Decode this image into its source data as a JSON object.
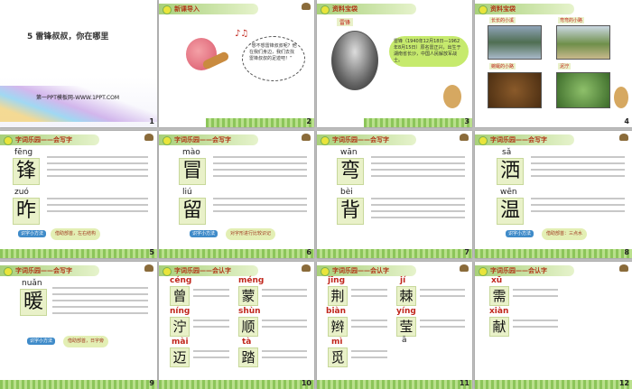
{
  "slides": [
    {
      "num": "1",
      "title": "5 雷锋叔叔，你在哪里",
      "footer": "第一PPT模板网-WWW.1PPT.COM"
    },
    {
      "num": "2",
      "header": "新课导入",
      "quote": "“想不想雷锋叔叔呢？他在我们身边，我们去找雷锋叔叔的足迹吧！”"
    },
    {
      "num": "3",
      "header": "资料宝袋",
      "label": "雷锋",
      "bio": "雷锋（1940年12月18日—1962年8月15日）原名雷正兴，出生于湖南省长沙，中国人民解放军战士。"
    },
    {
      "num": "4",
      "header": "资料宝袋",
      "captions": [
        "长长的小溪",
        "弯弯的小路",
        "蜿蜒的小路",
        "泥泞"
      ]
    },
    {
      "num": "5",
      "header": "字词乐园——会写字",
      "chars": [
        {
          "py": "fēng",
          "c": "锋"
        },
        {
          "py": "zuó",
          "c": "昨"
        }
      ],
      "btn": "识字小方法",
      "tip": "借助部首，左右结构"
    },
    {
      "num": "6",
      "header": "字词乐园——会写字",
      "chars": [
        {
          "py": "mào",
          "c": "冒"
        },
        {
          "py": "liú",
          "c": "留"
        }
      ],
      "btn": "识字小方法",
      "tip": "对字形进行比较识记"
    },
    {
      "num": "7",
      "header": "字词乐园——会写字",
      "chars": [
        {
          "py": "wān",
          "c": "弯"
        },
        {
          "py": "bèi",
          "c": "背"
        }
      ]
    },
    {
      "num": "8",
      "header": "字词乐园——会写字",
      "chars": [
        {
          "py": "sǎ",
          "c": "洒"
        },
        {
          "py": "wēn",
          "c": "温"
        }
      ],
      "btn": "识字小方法",
      "tip": "借助部首：三点水"
    },
    {
      "num": "9",
      "header": "字词乐园——会写字",
      "chars": [
        {
          "py": "nuǎn",
          "c": "暖"
        }
      ],
      "btn": "识字小方法",
      "tip": "借助部首，日字旁"
    },
    {
      "num": "10",
      "header": "字词乐园——会认字",
      "chars": [
        {
          "py": "céng",
          "c": "曾"
        },
        {
          "py": "méng",
          "c": "蒙"
        },
        {
          "py": "níng",
          "c": "泞"
        },
        {
          "py": "shùn",
          "c": "顺"
        },
        {
          "py": "mài",
          "c": "迈"
        },
        {
          "py": "tà",
          "c": "踏"
        }
      ]
    },
    {
      "num": "11",
      "header": "字词乐园——会认字",
      "chars": [
        {
          "py": "jīng",
          "c": "荆"
        },
        {
          "py": "jí",
          "c": "棘"
        },
        {
          "py": "biàn",
          "c": "辫"
        },
        {
          "py": "yíng",
          "c": "莹"
        },
        {
          "py": "mì",
          "c": "觅"
        },
        {
          "py": "",
          "c": ""
        }
      ],
      "extra": "ā"
    },
    {
      "num": "12",
      "header": "字词乐园——会认字",
      "chars": [
        {
          "py": "xū",
          "c": "需"
        },
        {
          "py": "xiàn",
          "c": "献"
        }
      ]
    }
  ],
  "colors": {
    "accent": "#c1271d",
    "panel": "#e9f1c9",
    "grass": "#8cc55a"
  }
}
